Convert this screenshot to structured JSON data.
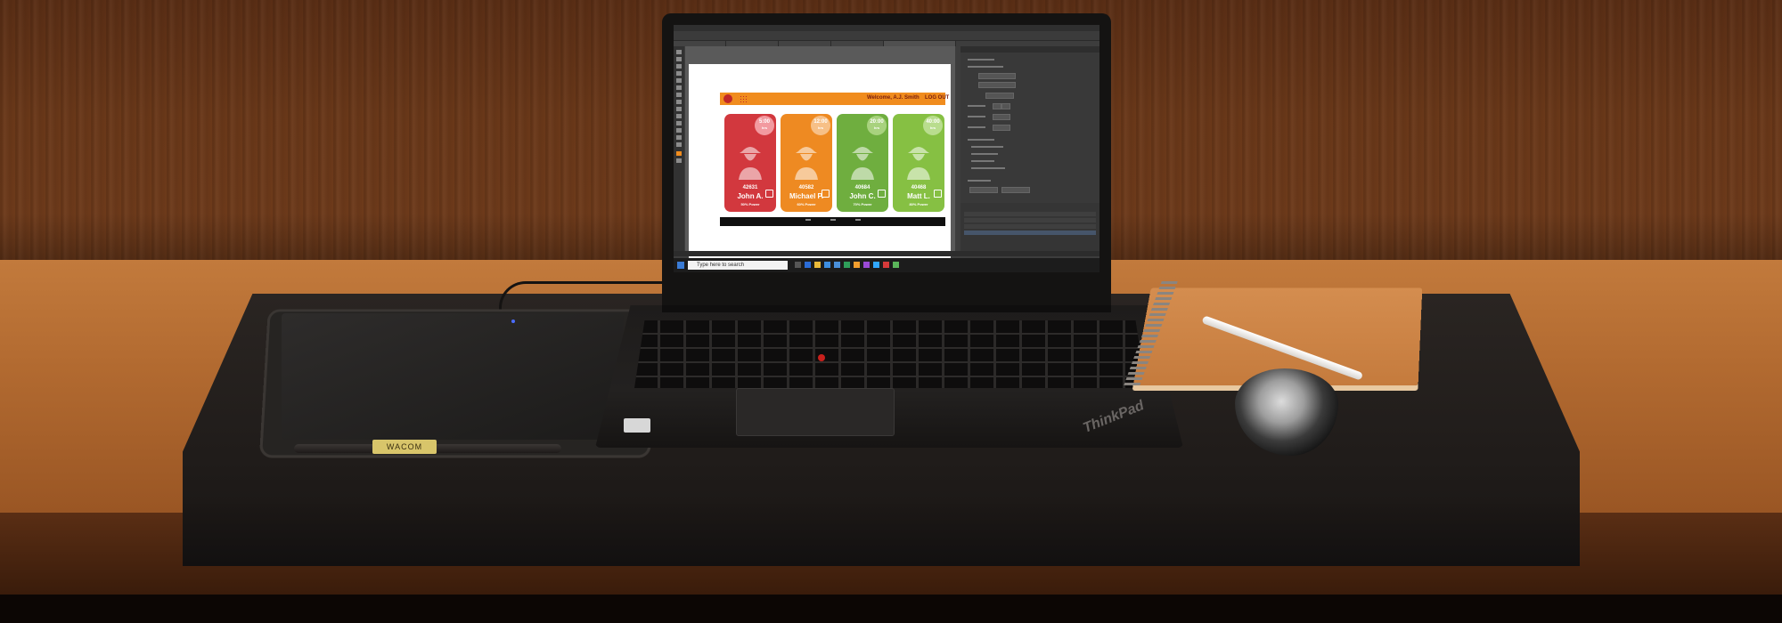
{
  "scene": {
    "description_free": true,
    "colors": {
      "wall": "#6a3819",
      "desk": "#c27a3c",
      "mat": "#221e1b",
      "card_red": "#d2383e",
      "card_orange": "#ee8a22",
      "card_green_1": "#6fae3f",
      "card_green_2": "#86c043",
      "header_orange": "#f08c1e"
    }
  },
  "laptop": {
    "brand": "ThinkPad",
    "screen": {
      "app": {
        "tabs_count_visible": 5
      },
      "artboard": {
        "header": {
          "welcome": "Welcome, A.J. Smith",
          "logout": "LOG OUT"
        },
        "cards": [
          {
            "id": "42631",
            "name": "John A.",
            "power": "50% Power",
            "badge_value": "5:00",
            "badge_unit": "hrs",
            "color": "#d2383e",
            "badge_color": "#f29aa0"
          },
          {
            "id": "40582",
            "name": "Michael P.",
            "power": "60% Power",
            "badge_value": "12:00",
            "badge_unit": "hrs",
            "color": "#ee8a22",
            "badge_color": "#f7c087"
          },
          {
            "id": "40684",
            "name": "John C.",
            "power": "70% Power",
            "badge_value": "20:00",
            "badge_unit": "hrs",
            "color": "#6fae3f",
            "badge_color": "#a8d27e"
          },
          {
            "id": "40468",
            "name": "Matt L.",
            "power": "80% Power",
            "badge_value": "40:00",
            "badge_unit": "hrs",
            "color": "#86c043",
            "badge_color": "#b9dd8e"
          }
        ]
      },
      "taskbar": {
        "search_placeholder": "Type here to search"
      }
    }
  },
  "tablet": {
    "label": "WACOM"
  },
  "icons": [
    "windows-icon",
    "search-icon",
    "notebook-icon",
    "pen-icon",
    "mouse-icon"
  ]
}
